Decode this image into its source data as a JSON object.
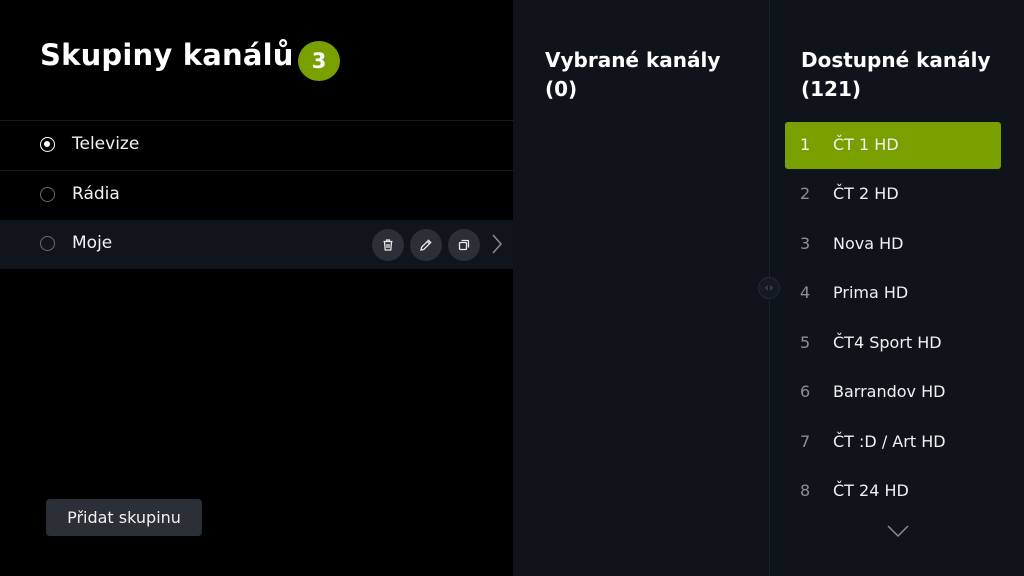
{
  "groups_panel": {
    "title": "Skupiny kanálů",
    "count_badge": "3",
    "groups": [
      {
        "label": "Televize",
        "selected": true
      },
      {
        "label": "Rádia",
        "selected": false
      },
      {
        "label": "Moje",
        "selected": false
      }
    ],
    "row_actions": {
      "delete_icon": "trash-icon",
      "edit_icon": "pencil-icon",
      "copy_icon": "copy-icon",
      "expand_icon": "chevron-right-icon"
    },
    "add_button_label": "Přidat skupinu"
  },
  "selected_panel": {
    "title_line1": "Vybrané kanály",
    "title_line2": "(0)"
  },
  "available_panel": {
    "title_line1": "Dostupné kanály",
    "title_line2": "(121)",
    "channels": [
      {
        "number": "1",
        "name": "ČT 1 HD",
        "active": true
      },
      {
        "number": "2",
        "name": "ČT 2 HD"
      },
      {
        "number": "3",
        "name": "Nova HD"
      },
      {
        "number": "4",
        "name": "Prima HD"
      },
      {
        "number": "5",
        "name": "ČT4 Sport HD"
      },
      {
        "number": "6",
        "name": "Barrandov HD"
      },
      {
        "number": "7",
        "name": "ČT :D / Art HD"
      },
      {
        "number": "8",
        "name": "ČT 24 HD"
      }
    ]
  },
  "colors": {
    "accent": "#7aa000",
    "panel_bg": "#0f131a",
    "button_bg": "#2b2f36"
  }
}
